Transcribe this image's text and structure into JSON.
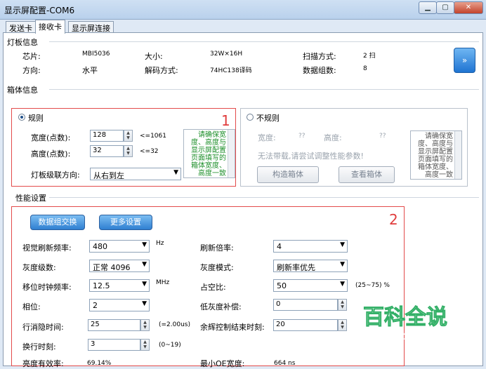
{
  "window": {
    "title": "显示屏配置-COM6",
    "min": "▁",
    "max": "▢",
    "close": "✕"
  },
  "tabs": [
    {
      "label": "发送卡"
    },
    {
      "label": "接收卡"
    },
    {
      "label": "显示屏连接"
    }
  ],
  "panel_info": {
    "title": "灯板信息",
    "chip_label": "芯片:",
    "chip_value": "MBI5036",
    "size_label": "大小:",
    "size_value": "32W×16H",
    "scan_label": "扫描方式:",
    "scan_value": "2 扫",
    "dir_label": "方向:",
    "dir_value": "水平",
    "decode_label": "解码方式:",
    "decode_value": "74HC138译码",
    "groups_label": "数据组数:",
    "groups_value": "8",
    "more_arrow": "»"
  },
  "cabinet": {
    "title": "箱体信息",
    "regular_label": "规则",
    "width_label": "宽度(点数):",
    "width_value": "128",
    "width_max": "<=1061",
    "height_label": "高度(点数):",
    "height_value": "32",
    "height_max": "<=32",
    "cascade_label": "灯板级联方向:",
    "cascade_value": "从右到左",
    "hint": "请确保宽度、高度与显示屏配置页面填写的箱体宽度、高度一致",
    "box_number": "1",
    "irregular_label": "不规则",
    "irr_width_label": "宽度:",
    "irr_width_value": "??",
    "irr_height_label": "高度:",
    "irr_height_value": "??",
    "irr_notice": "无法带载,请尝试调整性能参数!",
    "construct_btn": "构造箱体",
    "view_btn": "查看箱体",
    "irr_hint": "请确保宽度、高度与显示屏配置页面填写的箱体宽度、高度一致"
  },
  "performance": {
    "title": "性能设置",
    "box_number": "2",
    "swap_btn": "数据组交换",
    "more_btn": "更多设置",
    "refresh_label": "视觉刷新频率:",
    "refresh_value": "480",
    "refresh_unit": "Hz",
    "mult_label": "刷新倍率:",
    "mult_value": "4",
    "gray_label": "灰度级数:",
    "gray_value": "正常 4096",
    "graymode_label": "灰度模式:",
    "graymode_value": "刷新率优先",
    "clock_label": "移位时钟频率:",
    "clock_value": "12.5",
    "clock_unit": "MHz",
    "duty_label": "占空比:",
    "duty_value": "50",
    "duty_range": "(25~75) %",
    "phase_label": "相位:",
    "phase_value": "2",
    "lowgray_label": "低灰度补偿:",
    "lowgray_value": "0",
    "line_label": "行消隐时间:",
    "line_value": "25",
    "line_unit": "(=2.00us)",
    "ghost_label": "余辉控制结束时刻:",
    "ghost_value": "20",
    "switch_label": "换行时刻:",
    "switch_value": "3",
    "switch_range": "(0~19)",
    "eff_label": "亮度有效率:",
    "eff_value": "69.14%",
    "oe_label": "最小OE宽度:",
    "oe_value": "664 ns"
  },
  "watermark": {
    "line1": "百科全说",
    "line2": "助你轻松解决"
  },
  "colors": {
    "accent_red": "#e34b4b",
    "button_blue": "#2f7fd1",
    "watermark_green": "#33b067"
  },
  "icons": {
    "dropdown": "▼",
    "spin_up": "▲",
    "spin_down": "▼"
  }
}
